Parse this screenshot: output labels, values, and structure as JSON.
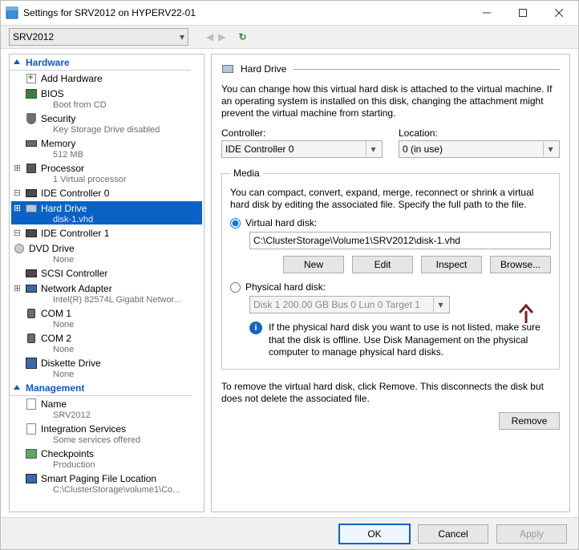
{
  "window": {
    "title": "Settings for SRV2012 on HYPERV22-01",
    "vm_selected": "SRV2012"
  },
  "tree": {
    "hardware_label": "Hardware",
    "management_label": "Management",
    "nodes": {
      "add_hw": {
        "label": "Add Hardware"
      },
      "bios": {
        "label": "BIOS",
        "sub": "Boot from CD"
      },
      "security": {
        "label": "Security",
        "sub": "Key Storage Drive disabled"
      },
      "memory": {
        "label": "Memory",
        "sub": "512 MB"
      },
      "cpu": {
        "label": "Processor",
        "sub": "1 Virtual processor"
      },
      "ide0": {
        "label": "IDE Controller 0"
      },
      "hdd": {
        "label": "Hard Drive",
        "sub": "disk-1.vhd"
      },
      "ide1": {
        "label": "IDE Controller 1"
      },
      "dvd": {
        "label": "DVD Drive",
        "sub": "None"
      },
      "scsi": {
        "label": "SCSI Controller"
      },
      "net": {
        "label": "Network Adapter",
        "sub": "Intel(R) 82574L Gigabit Networ..."
      },
      "com1": {
        "label": "COM 1",
        "sub": "None"
      },
      "com2": {
        "label": "COM 2",
        "sub": "None"
      },
      "fdd": {
        "label": "Diskette Drive",
        "sub": "None"
      },
      "name": {
        "label": "Name",
        "sub": "SRV2012"
      },
      "svc": {
        "label": "Integration Services",
        "sub": "Some services offered"
      },
      "chk": {
        "label": "Checkpoints",
        "sub": "Production"
      },
      "spf": {
        "label": "Smart Paging File Location",
        "sub": "C:\\ClusterStorage\\volume1\\Co..."
      }
    }
  },
  "panel": {
    "title": "Hard Drive",
    "intro": "You can change how this virtual hard disk is attached to the virtual machine. If an operating system is installed on this disk, changing the attachment might prevent the virtual machine from starting.",
    "controller_label": "Controller:",
    "controller_value": "IDE Controller 0",
    "location_label": "Location:",
    "location_value": "0 (in use)",
    "media": {
      "legend": "Media",
      "desc": "You can compact, convert, expand, merge, reconnect or shrink a virtual hard disk by editing the associated file. Specify the full path to the file.",
      "vhd_label": "Virtual hard disk:",
      "vhd_path": "C:\\ClusterStorage\\Volume1\\SRV2012\\disk-1.vhd",
      "phys_label": "Physical hard disk:",
      "phys_value": "Disk 1 200.00 GB Bus 0 Lun 0 Target 1",
      "info": "If the physical hard disk you want to use is not listed, make sure that the disk is offline. Use Disk Management on the physical computer to manage physical hard disks.",
      "btn_new": "New",
      "btn_edit": "Edit",
      "btn_inspect": "Inspect",
      "btn_browse": "Browse..."
    },
    "remove_text": "To remove the virtual hard disk, click Remove. This disconnects the disk but does not delete the associated file.",
    "btn_remove": "Remove"
  },
  "footer": {
    "ok": "OK",
    "cancel": "Cancel",
    "apply": "Apply"
  }
}
